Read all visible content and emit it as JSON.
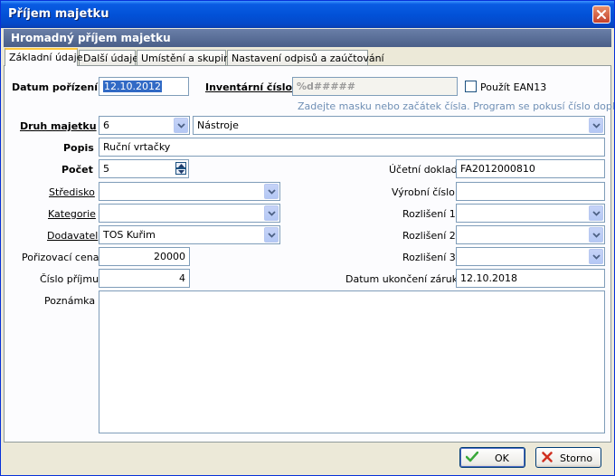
{
  "window": {
    "title": "Příjem majetku"
  },
  "banner": {
    "title": "Hromadný příjem majetku"
  },
  "tabs": [
    {
      "label": "Základní údaje",
      "active": true
    },
    {
      "label": "Další údaje",
      "active": false
    },
    {
      "label": "Umístění a skupina",
      "active": false
    },
    {
      "label": "Nastavení odpisů a zaúčtování",
      "active": false
    }
  ],
  "form": {
    "datum_porizeni": {
      "label": "Datum pořízení",
      "value": "12.10.2012"
    },
    "inventarni_cislo": {
      "label": "Inventární číslo",
      "value": "%d#####",
      "hint": "Zadejte masku nebo začátek čísla. Program se pokusí číslo doplnit."
    },
    "pouzit_ean13": {
      "label": "Použít EAN13",
      "checked": false
    },
    "druh_majetku": {
      "label": "Druh majetku",
      "code": "6",
      "name": "Nástroje"
    },
    "popis": {
      "label": "Popis",
      "value": "Ruční vrtačky"
    },
    "pocet": {
      "label": "Počet",
      "value": "5"
    },
    "ucetni_doklad": {
      "label": "Účetní doklad",
      "value": "FA2012000810"
    },
    "stredisko": {
      "label": "Středisko",
      "value": ""
    },
    "vyrobni_cislo": {
      "label": "Výrobní číslo",
      "value": ""
    },
    "kategorie": {
      "label": "Kategorie",
      "value": ""
    },
    "rozliseni1": {
      "label": "Rozlišení 1",
      "value": ""
    },
    "dodavatel": {
      "label": "Dodavatel",
      "value": "TOS Kuřim"
    },
    "rozliseni2": {
      "label": "Rozlišení 2",
      "value": ""
    },
    "porizovaci_cena": {
      "label": "Pořizovací cena",
      "value": "20000"
    },
    "rozliseni3": {
      "label": "Rozlišení 3",
      "value": ""
    },
    "cislo_prijmu": {
      "label": "Číslo příjmu",
      "value": "4"
    },
    "datum_ukonceni_zaruky": {
      "label": "Datum ukončení záruky",
      "value": "12.10.2018"
    },
    "poznamka": {
      "label": "Poznámka",
      "value": ""
    }
  },
  "buttons": {
    "ok": "OK",
    "cancel": "Storno"
  },
  "colors": {
    "titlebar": "#0252d8",
    "banner": "#5a6f98",
    "hint": "#6f8fb5",
    "selection": "#316ac5",
    "ok_icon": "#3aa83a",
    "cancel_icon": "#d03020"
  }
}
